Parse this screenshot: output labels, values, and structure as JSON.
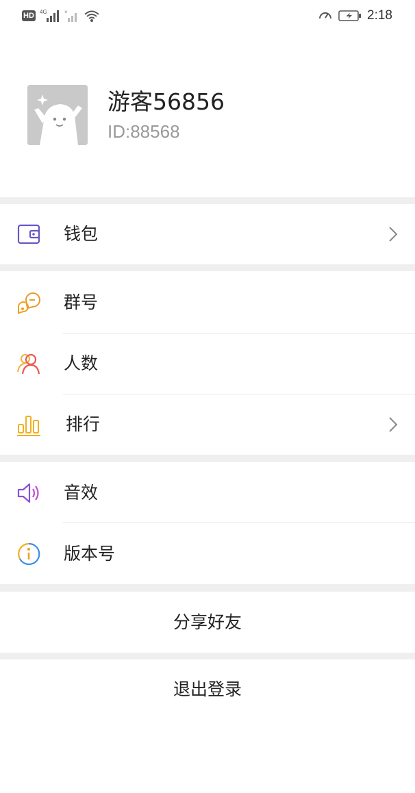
{
  "status_bar": {
    "left_badge": "HD",
    "network": "4G",
    "time": "2:18"
  },
  "profile": {
    "name": "游客56856",
    "id": "ID:88568"
  },
  "menu": {
    "wallet": "钱包",
    "group_number": "群号",
    "people_count": "人数",
    "ranking": "排行",
    "sound_effects": "音效",
    "version": "版本号"
  },
  "actions": {
    "share": "分享好友",
    "logout": "退出登录"
  },
  "icons": {
    "wallet": "wallet-icon",
    "group": "chat-bubbles-icon",
    "people": "people-icon",
    "ranking": "bar-chart-icon",
    "sound": "speaker-icon",
    "version": "info-icon",
    "chevron": "chevron-right-icon"
  },
  "colors": {
    "wallet_icon": "#6a54c9",
    "group_icon": "#f0a020",
    "people_icon": "#e85a4f",
    "ranking_icon": "#f0b020",
    "sound_icon": "#8a4fd8",
    "version_icon": "#3a8ee6",
    "separator": "#efefef"
  }
}
